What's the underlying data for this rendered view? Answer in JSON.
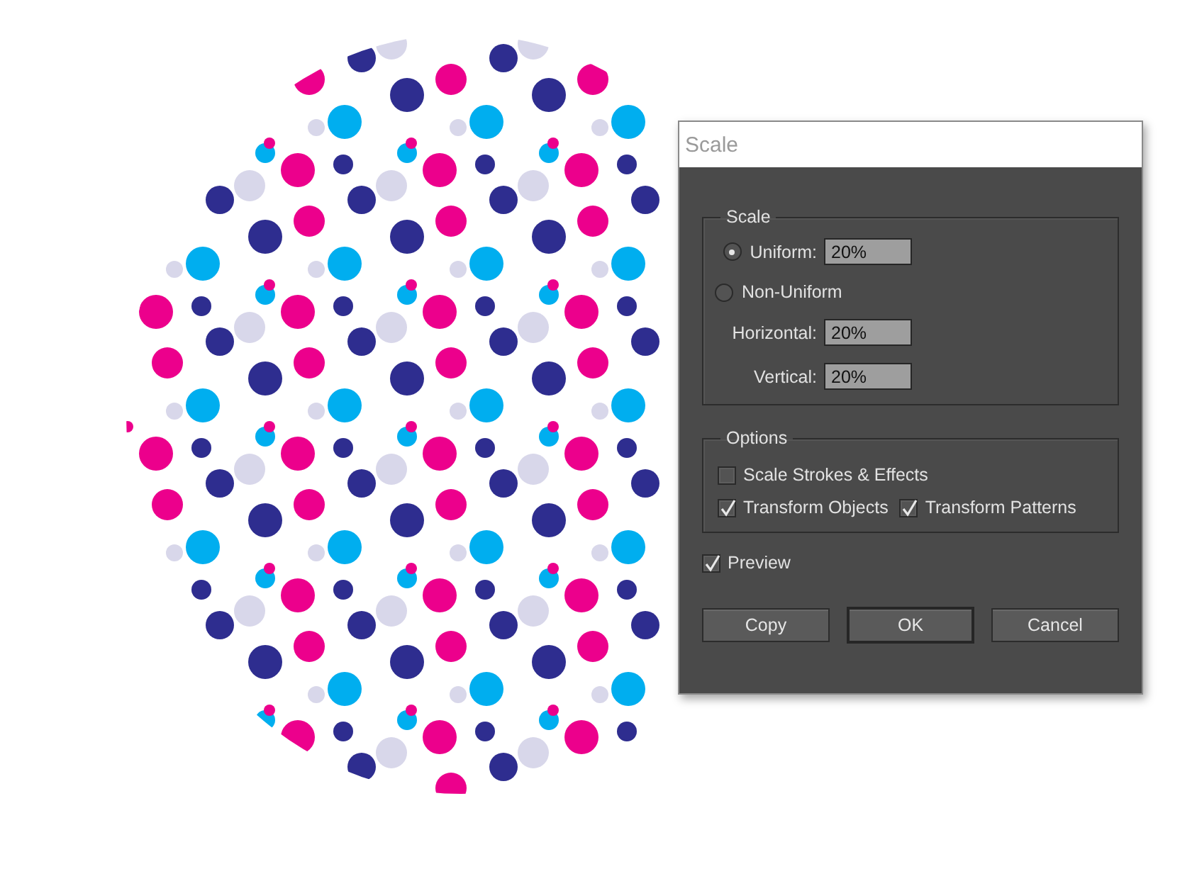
{
  "dialog": {
    "title": "Scale",
    "scale_group": {
      "label": "Scale",
      "modes": [
        {
          "label": "Uniform:",
          "selected": true,
          "value": "20%"
        },
        {
          "label": "Non-Uniform",
          "selected": false
        }
      ],
      "fields": [
        {
          "label": "Horizontal:",
          "value": "20%"
        },
        {
          "label": "Vertical:",
          "value": "20%"
        }
      ]
    },
    "options_group": {
      "label": "Options",
      "checkboxes": [
        {
          "label": "Scale Strokes & Effects",
          "checked": false
        },
        {
          "label": "Transform Objects",
          "checked": true
        },
        {
          "label": "Transform Patterns",
          "checked": true
        }
      ]
    },
    "preview": {
      "label": "Preview",
      "checked": true
    },
    "buttons": [
      {
        "label": "Copy",
        "default": false
      },
      {
        "label": "OK",
        "default": true
      },
      {
        "label": "Cancel",
        "default": false
      }
    ]
  }
}
